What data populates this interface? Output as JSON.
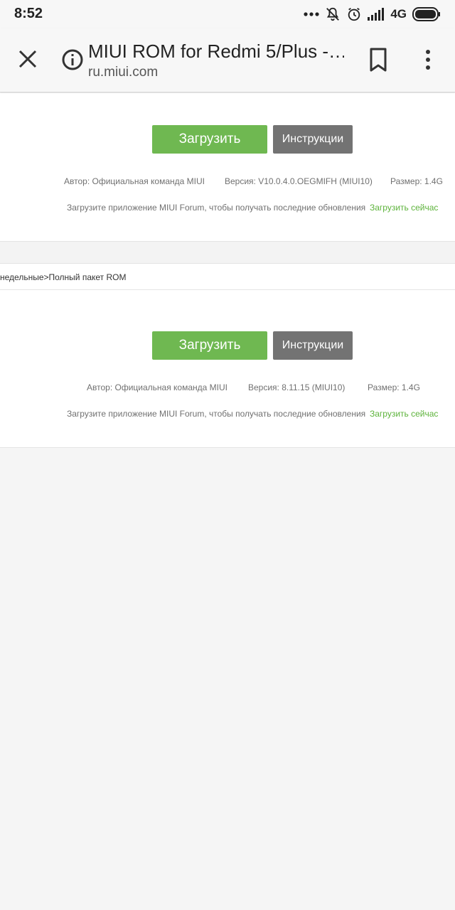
{
  "status_bar": {
    "time": "8:52",
    "network": "4G",
    "icons": [
      "more-dots-icon",
      "bell-off-icon",
      "alarm-icon",
      "signal-icon",
      "battery-icon"
    ]
  },
  "toolbar": {
    "title": "MIUI ROM for Redmi 5/Plus -…",
    "url": "ru.miui.com",
    "icons": [
      "close-icon",
      "info-icon",
      "bookmark-icon",
      "more-vert-icon"
    ]
  },
  "sections": [
    {
      "download_label": "Загрузить",
      "instructions_label": "Инструкции",
      "author": "Автор: Официальная команда MIUI",
      "version": "Версия: V10.0.4.0.OEGMIFH (MIUI10)",
      "size": "Размер: 1.4G",
      "promo": "Загрузите приложение MIUI Forum, чтобы получать последние обновления",
      "promo_link": "Загрузить сейчас"
    },
    {
      "download_label": "Загрузить",
      "instructions_label": "Инструкции",
      "author": "Автор: Официальная команда MIUI",
      "version": "Версия: 8.11.15 (MIUI10)",
      "size": "Размер: 1.4G",
      "promo": "Загрузите приложение MIUI Forum, чтобы получать последние обновления",
      "promo_link": "Загрузить сейчас"
    }
  ],
  "breadcrumb": "недельные>Полный пакет ROM",
  "colors": {
    "green": "#6fb851",
    "gray_button": "#737373",
    "link_green": "#5db33b"
  }
}
